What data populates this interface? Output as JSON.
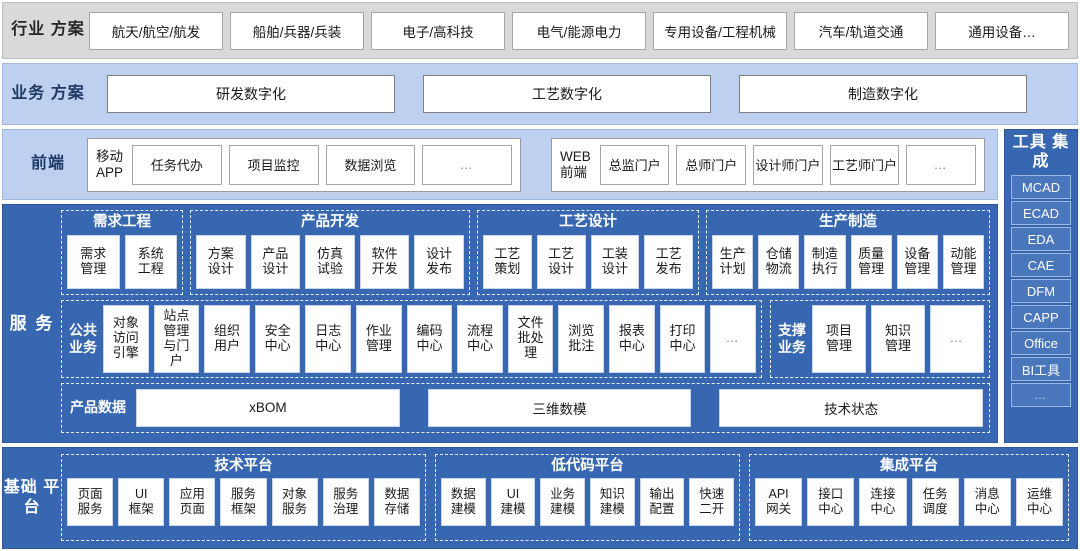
{
  "industry": {
    "label": "行业\n方案",
    "items": [
      "航天/航空/航发",
      "船舶/兵器/兵装",
      "电子/高科技",
      "电气/能源电力",
      "专用设备/工程机械",
      "汽车/轨道交通",
      "通用设备…"
    ]
  },
  "business": {
    "label": "业务\n方案",
    "items": [
      "研发数字化",
      "工艺数字化",
      "制造数字化"
    ]
  },
  "frontend": {
    "label": "前端",
    "groups": [
      {
        "title": "移动\nAPP",
        "items": [
          "任务代办",
          "项目监控",
          "数据浏览",
          "…"
        ]
      },
      {
        "title": "WEB\n前端",
        "items": [
          "总监门户",
          "总师门户",
          "设计师门户",
          "工艺师门户",
          "…"
        ]
      }
    ]
  },
  "tools": {
    "title": "工具\n集成",
    "items": [
      "MCAD",
      "ECAD",
      "EDA",
      "CAE",
      "DFM",
      "CAPP",
      "Office",
      "BI工具",
      "…"
    ]
  },
  "services": {
    "label": "服\n务",
    "band1": [
      {
        "title": "需求工程",
        "items": [
          "需求\n管理",
          "系统\n工程"
        ]
      },
      {
        "title": "产品开发",
        "items": [
          "方案\n设计",
          "产品\n设计",
          "仿真\n试验",
          "软件\n开发",
          "设计\n发布"
        ]
      },
      {
        "title": "工艺设计",
        "items": [
          "工艺\n策划",
          "工艺\n设计",
          "工装\n设计",
          "工艺\n发布"
        ]
      },
      {
        "title": "生产制造",
        "items": [
          "生产\n计划",
          "仓储\n物流",
          "制造\n执行",
          "质量\n管理",
          "设备\n管理",
          "动能\n管理"
        ]
      }
    ],
    "band2": [
      {
        "title": "公共\n业务",
        "items": [
          "对象\n访问\n引擎",
          "站点\n管理\n与门\n户",
          "组织\n用户",
          "安全\n中心",
          "日志\n中心",
          "作业\n管理",
          "编码\n中心",
          "流程\n中心",
          "文件\n批处\n理",
          "浏览\n批注",
          "报表\n中心",
          "打印\n中心",
          "…"
        ]
      },
      {
        "title": "支撑\n业务",
        "items": [
          "项目\n管理",
          "知识\n管理",
          "…"
        ]
      }
    ],
    "band3": {
      "title": "产品数据",
      "items": [
        "xBOM",
        "三维数模",
        "技术状态"
      ]
    }
  },
  "foundation": {
    "label": "基础\n平台",
    "groups": [
      {
        "title": "技术平台",
        "items": [
          "页面\n服务",
          "UI\n框架",
          "应用\n页面",
          "服务\n框架",
          "对象\n服务",
          "服务\n治理",
          "数据\n存储"
        ]
      },
      {
        "title": "低代码平台",
        "items": [
          "数据\n建模",
          "UI\n建模",
          "业务\n建模",
          "知识\n建模",
          "输出\n配置",
          "快速\n二开"
        ]
      },
      {
        "title": "集成平台",
        "items": [
          "API\n网关",
          "接口\n中心",
          "连接\n中心",
          "任务\n调度",
          "消息\n中心",
          "运维\n中心"
        ]
      }
    ]
  },
  "colors": {
    "industry_bg": "#d9d9d9",
    "business_bg": "#bdd0ef",
    "frontend_bg": "#bdd0ef",
    "services_bg": "#3767b1",
    "foundation_bg": "#3767b1",
    "tool_chip_bg": "#4a76bb"
  }
}
